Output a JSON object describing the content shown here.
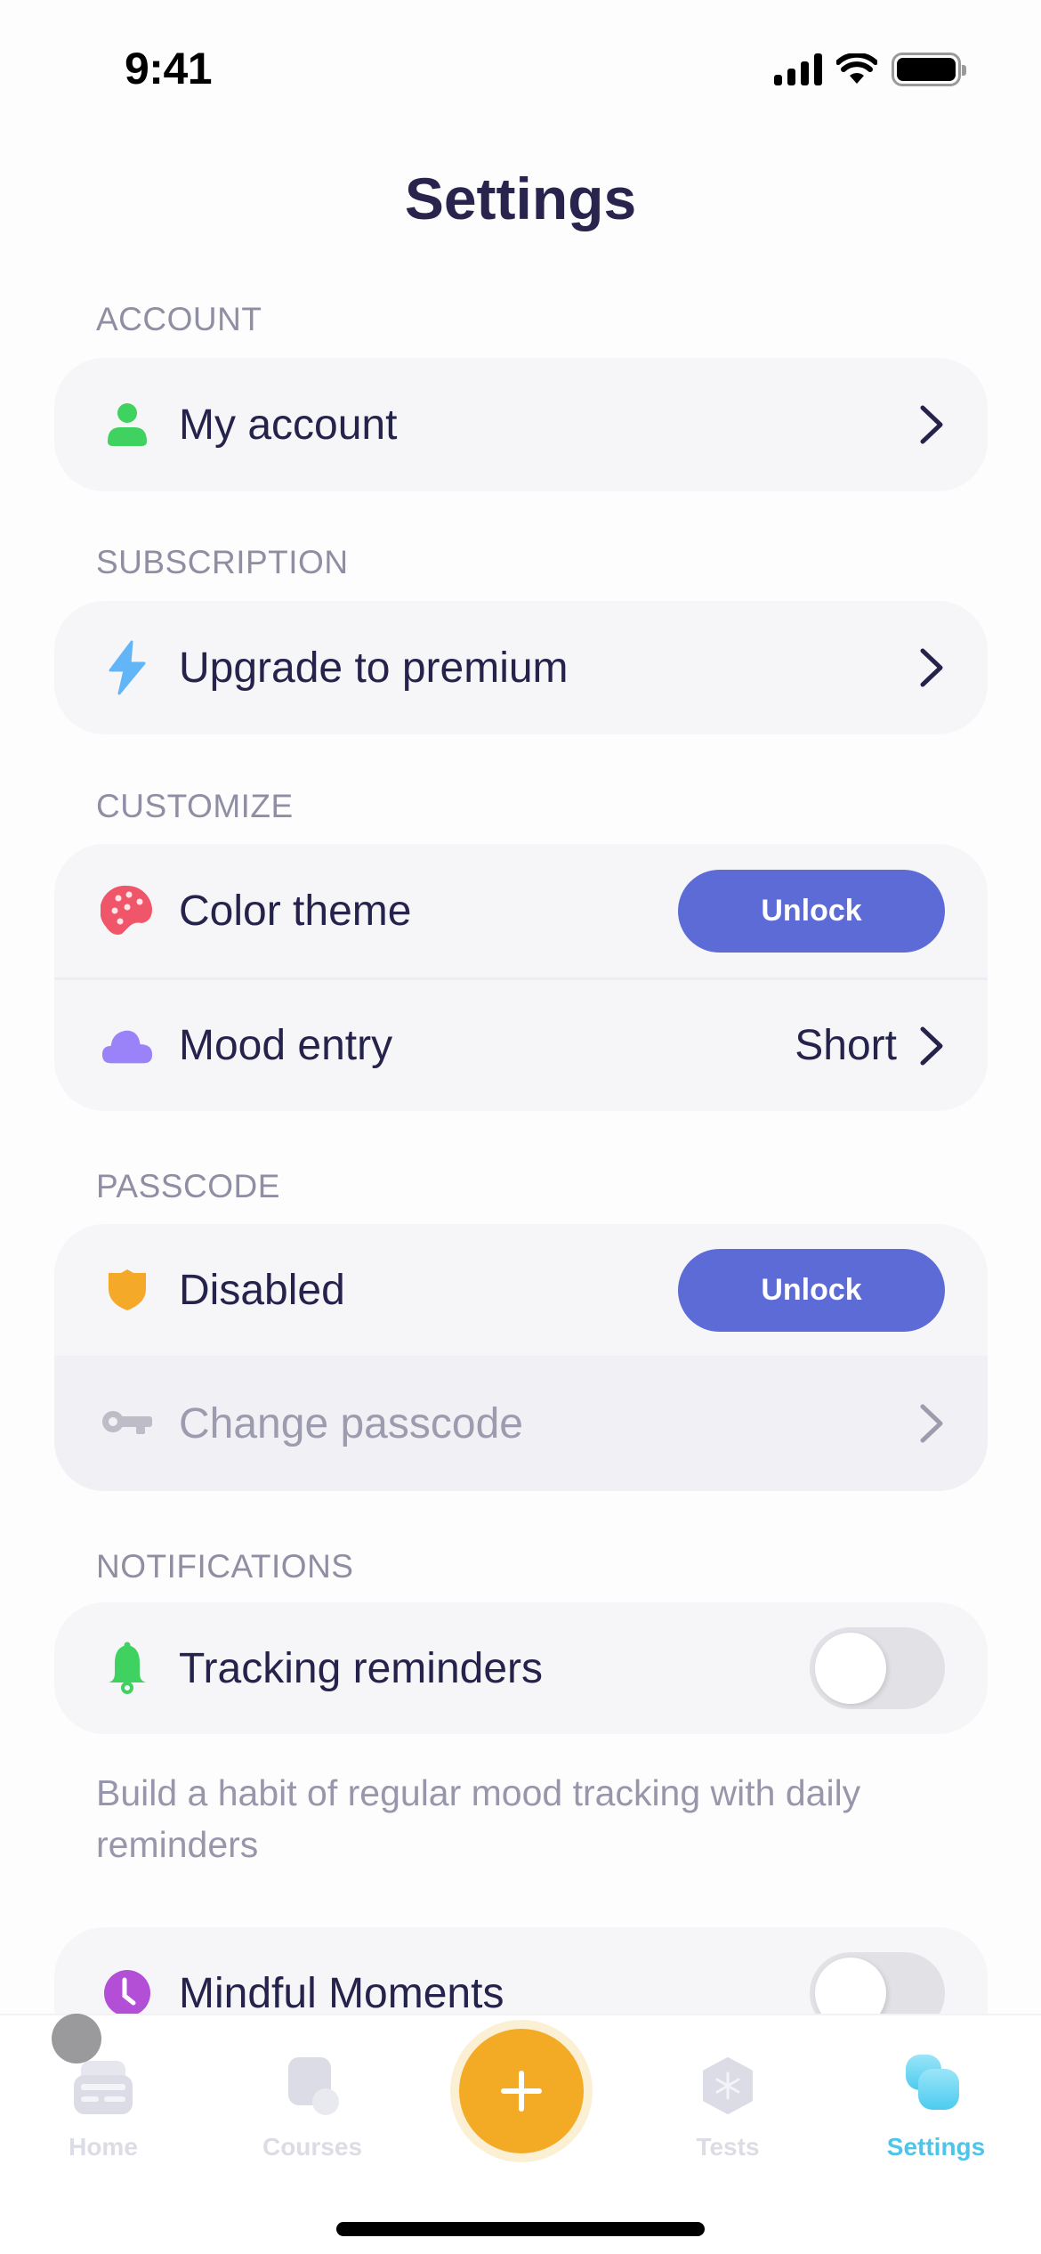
{
  "status_bar": {
    "time": "9:41"
  },
  "header": {
    "title": "Settings"
  },
  "sections": {
    "account": {
      "label": "ACCOUNT",
      "rows": [
        {
          "icon": "person-icon",
          "label": "My account"
        }
      ]
    },
    "subscription": {
      "label": "SUBSCRIPTION",
      "rows": [
        {
          "icon": "lightning-icon",
          "label": "Upgrade to premium"
        }
      ]
    },
    "customize": {
      "label": "CUSTOMIZE",
      "rows": [
        {
          "icon": "palette-icon",
          "label": "Color theme",
          "button": "Unlock"
        },
        {
          "icon": "cloud-icon",
          "label": "Mood entry",
          "value": "Short"
        }
      ]
    },
    "passcode": {
      "label": "PASSCODE",
      "rows": [
        {
          "icon": "shield-icon",
          "label": "Disabled",
          "button": "Unlock"
        },
        {
          "icon": "key-icon",
          "label": "Change passcode",
          "disabled": true
        }
      ]
    },
    "notifications": {
      "label": "NOTIFICATIONS",
      "rows": [
        {
          "icon": "bell-icon",
          "label": "Tracking reminders",
          "toggle_on": false
        },
        {
          "icon": "clock-icon",
          "label": "Mindful Moments",
          "toggle_on": false
        }
      ],
      "description": "Build a habit of regular mood tracking with daily reminders"
    }
  },
  "tabbar": {
    "tabs": [
      {
        "label": "Home",
        "icon": "home-icon",
        "active": false
      },
      {
        "label": "Courses",
        "icon": "courses-icon",
        "active": false
      },
      {
        "label": "Tests",
        "icon": "tests-icon",
        "active": false
      },
      {
        "label": "Settings",
        "icon": "settings-icon",
        "active": true
      }
    ],
    "add_icon": "plus-icon"
  },
  "colors": {
    "accent": "#5C6BD6",
    "fab": "#F3AA25",
    "active_tab": "#4EC5E8",
    "text_primary": "#25224C",
    "text_secondary": "#8F8EA3"
  }
}
